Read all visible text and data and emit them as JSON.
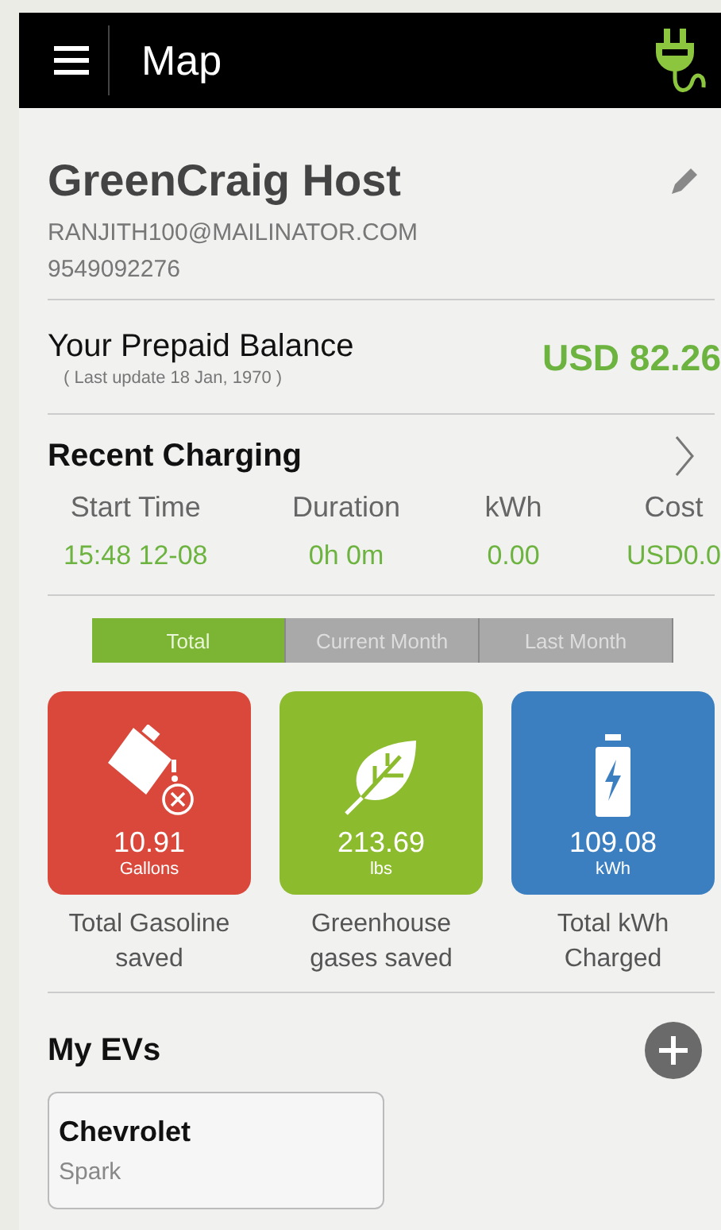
{
  "header": {
    "title": "Map"
  },
  "profile": {
    "name": "GreenCraig Host",
    "email": "RANJITH100@MAILINATOR.COM",
    "phone": "9549092276"
  },
  "balance": {
    "label": "Your Prepaid Balance",
    "updated": "( Last update 18 Jan, 1970 )",
    "amount": "USD 82.26"
  },
  "recent_charging": {
    "title": "Recent Charging",
    "columns": [
      {
        "heading": "Start Time",
        "value": "15:48 12-08"
      },
      {
        "heading": "Duration",
        "value": "0h 0m"
      },
      {
        "heading": "kWh",
        "value": "0.00"
      },
      {
        "heading": "Cost",
        "value": "USD0.0"
      }
    ]
  },
  "period_tabs": [
    {
      "label": "Total",
      "selected": true
    },
    {
      "label": "Current Month",
      "selected": false
    },
    {
      "label": "Last Month",
      "selected": false
    }
  ],
  "stats": [
    {
      "kind": "gasoline",
      "color": "#d9483b",
      "value": "10.91",
      "unit": "Gallons",
      "caption": "Total Gasoline saved"
    },
    {
      "kind": "leaf",
      "color": "#8cbb2e",
      "value": "213.69",
      "unit": "lbs",
      "caption": "Greenhouse gases saved"
    },
    {
      "kind": "battery",
      "color": "#3b7fc0",
      "value": "109.08",
      "unit": "kWh",
      "caption": "Total kWh Charged"
    }
  ],
  "my_evs": {
    "title": "My EVs",
    "vehicles": [
      {
        "make": "Chevrolet",
        "model": "Spark"
      }
    ]
  }
}
